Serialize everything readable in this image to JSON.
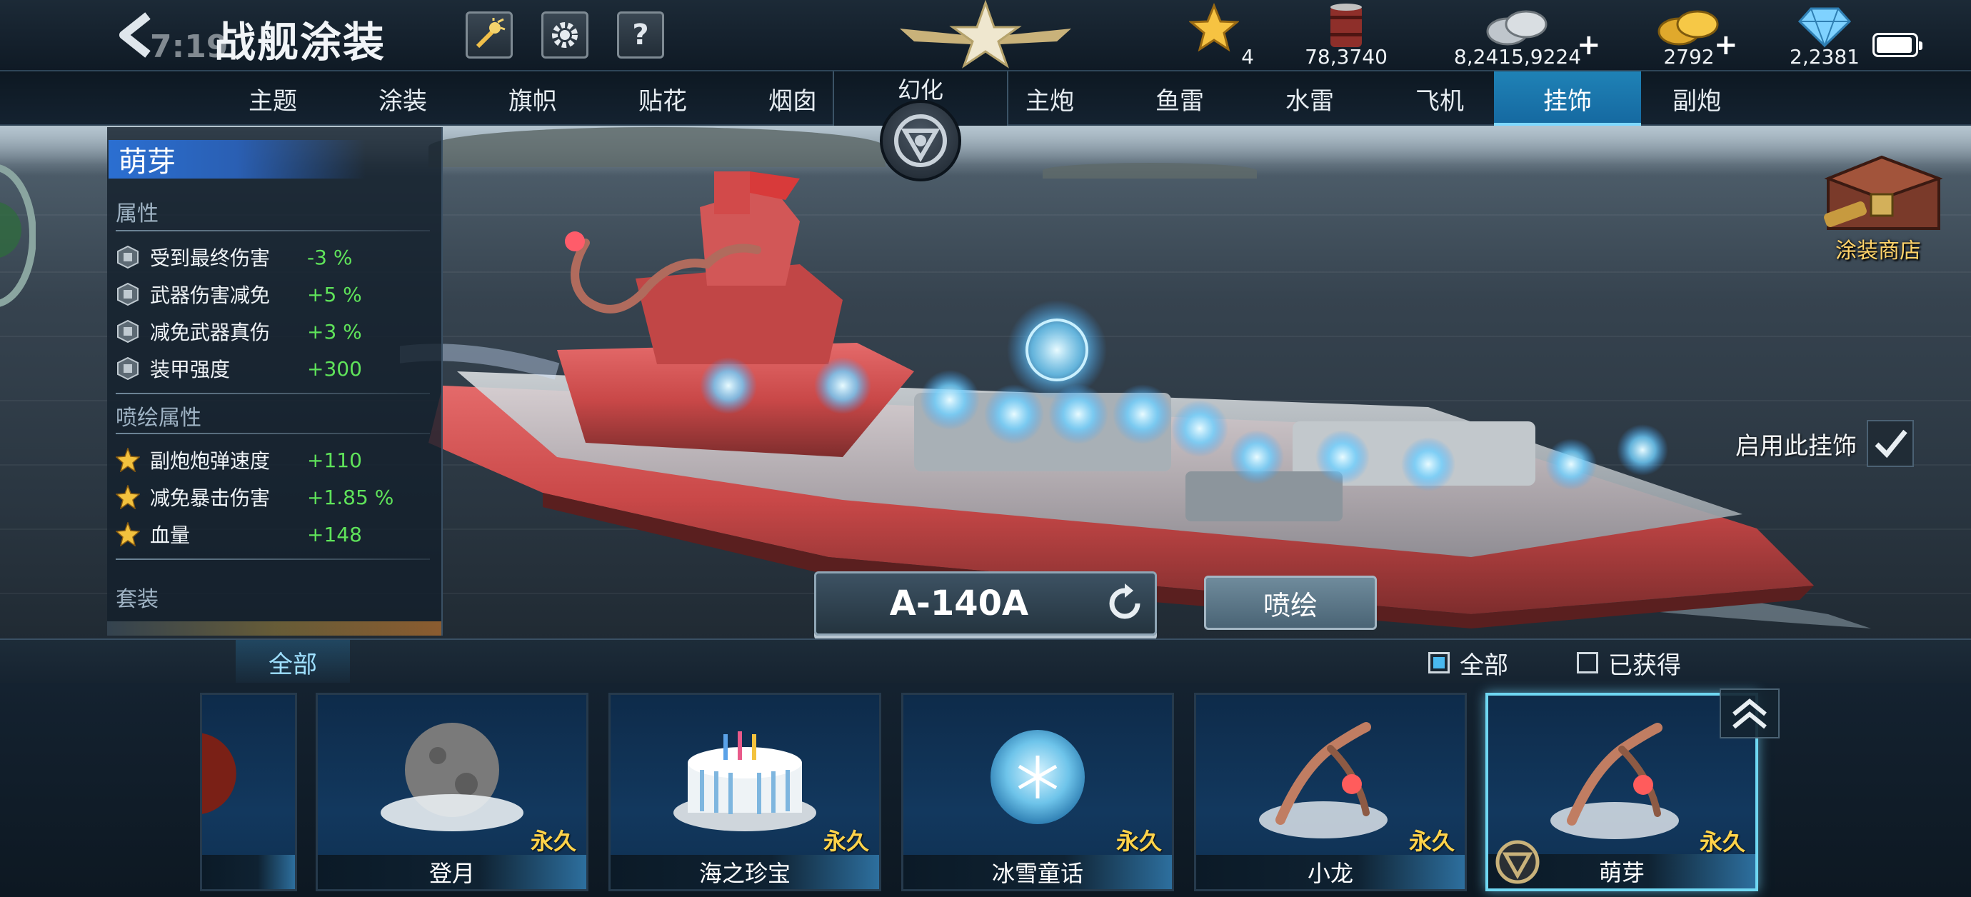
{
  "top_bar": {
    "clock": "7:19",
    "title": "战舰涂装",
    "help_label": "?",
    "resources": [
      {
        "icon": "star-icon",
        "value": "4"
      },
      {
        "icon": "oil-barrel-icon",
        "value": "78,3740"
      },
      {
        "icon": "silver-coins-icon",
        "value": "8,2415,9224"
      },
      {
        "icon": "gold-coins-icon",
        "value": "2792"
      },
      {
        "icon": "diamond-icon",
        "value": "2,2381"
      }
    ],
    "battery_level": 0.95
  },
  "tabs": {
    "left": [
      "主题",
      "涂装",
      "旗帜",
      "贴花",
      "烟囱"
    ],
    "center": "幻化",
    "right": [
      "主炮",
      "鱼雷",
      "水雷",
      "飞机",
      "挂饰",
      "副炮"
    ],
    "active": "挂饰"
  },
  "panel": {
    "title": "萌芽",
    "attributes_header": "属性",
    "attributes": [
      {
        "name": "受到最终伤害",
        "value": "-3 %"
      },
      {
        "name": "武器伤害减免",
        "value": "+5 %"
      },
      {
        "name": "减免武器真伤",
        "value": "+3 %"
      },
      {
        "name": "装甲强度",
        "value": "+300"
      }
    ],
    "spray_header": "喷绘属性",
    "spray_attributes": [
      {
        "name": "副炮炮弹速度",
        "value": "+110"
      },
      {
        "name": "减免暴击伤害",
        "value": "+1.85 %"
      },
      {
        "name": "血量",
        "value": "+148"
      }
    ],
    "set_header": "套装"
  },
  "shop": {
    "label": "涂装商店"
  },
  "enable_toggle": {
    "label": "启用此挂饰",
    "checked": true
  },
  "ship": {
    "code": "A-140A"
  },
  "spray_button": "喷绘",
  "filter": {
    "tab": "全部",
    "options": [
      {
        "label": "全部",
        "checked": true
      },
      {
        "label": "已获得",
        "checked": false
      }
    ]
  },
  "cards": [
    {
      "name": "",
      "badge": "",
      "art": "red-orb"
    },
    {
      "name": "登月",
      "badge": "永久",
      "art": "moon"
    },
    {
      "name": "海之珍宝",
      "badge": "永久",
      "art": "cake"
    },
    {
      "name": "冰雪童话",
      "badge": "永久",
      "art": "snow-globe"
    },
    {
      "name": "小龙",
      "badge": "永久",
      "art": "dragon"
    },
    {
      "name": "萌芽",
      "badge": "永久",
      "art": "dragon",
      "selected": true
    }
  ],
  "colors": {
    "accent": "#1f82b6",
    "positive": "#5fe35a",
    "gold": "#ffd34a",
    "panel_title": "#2b6fd1"
  }
}
